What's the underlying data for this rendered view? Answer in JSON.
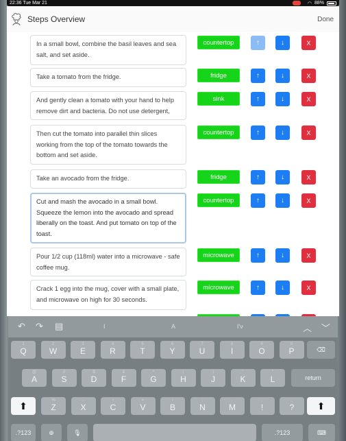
{
  "status": {
    "time": "22:36",
    "date": "Tue Mar 21",
    "battery": "88%"
  },
  "header": {
    "title": "Steps Overview",
    "done_label": "Done"
  },
  "buttons": {
    "up": "↑",
    "down": "↓",
    "delete": "X"
  },
  "steps": [
    {
      "text": "In a small bowl, combine the basil leaves and sea salt, and set aside.",
      "location": "countertop"
    },
    {
      "text": "Take a tomato from the fridge.",
      "location": "fridge"
    },
    {
      "text": "And gently clean a tomato with your hand to help remove dirt and bacteria. Do not use detergent,",
      "location": "sink"
    },
    {
      "text": "Then cut the tomato into parallel thin slices working from the top of the tomato towards the bottom and set aside.",
      "location": "countertop"
    },
    {
      "text": "Take an avocado from the fridge.",
      "location": "fridge"
    },
    {
      "text": "Cut and mash the avocado in a small bowl. Squeeze the lemon into the avocado and spread liberally on the toast. And put tomato on top of the toast.",
      "location": "countertop"
    },
    {
      "text": "Pour 1/2 cup (118ml) water into a microwave - safe coffee mug.",
      "location": "microwave"
    },
    {
      "text": "Crack 1 egg into the mug, cover with a small plate, and microwave on high for 30 seconds.",
      "location": "microwave"
    }
  ],
  "keyboard": {
    "suggestions": [
      "I",
      "A",
      "I'v"
    ],
    "row1": [
      "Q",
      "W",
      "E",
      "R",
      "T",
      "Y",
      "U",
      "I",
      "O",
      "P"
    ],
    "row1_hints": [
      "1",
      "2",
      "3",
      "4",
      "5",
      "6",
      "7",
      "8",
      "9",
      "0"
    ],
    "row2": [
      "A",
      "S",
      "D",
      "F",
      "G",
      "H",
      "J",
      "K",
      "L"
    ],
    "row2_hints": [
      "@",
      "#",
      "$",
      "&",
      "*",
      "(",
      ")",
      "'",
      "\""
    ],
    "row3": [
      "Z",
      "X",
      "C",
      "V",
      "B",
      "N",
      "M",
      "!",
      "?"
    ],
    "row3_hints": [
      "%",
      "-",
      "+",
      "=",
      "/",
      ";",
      ":",
      ",",
      "."
    ],
    "return_label": "return",
    "numbers_label": ".?123"
  }
}
